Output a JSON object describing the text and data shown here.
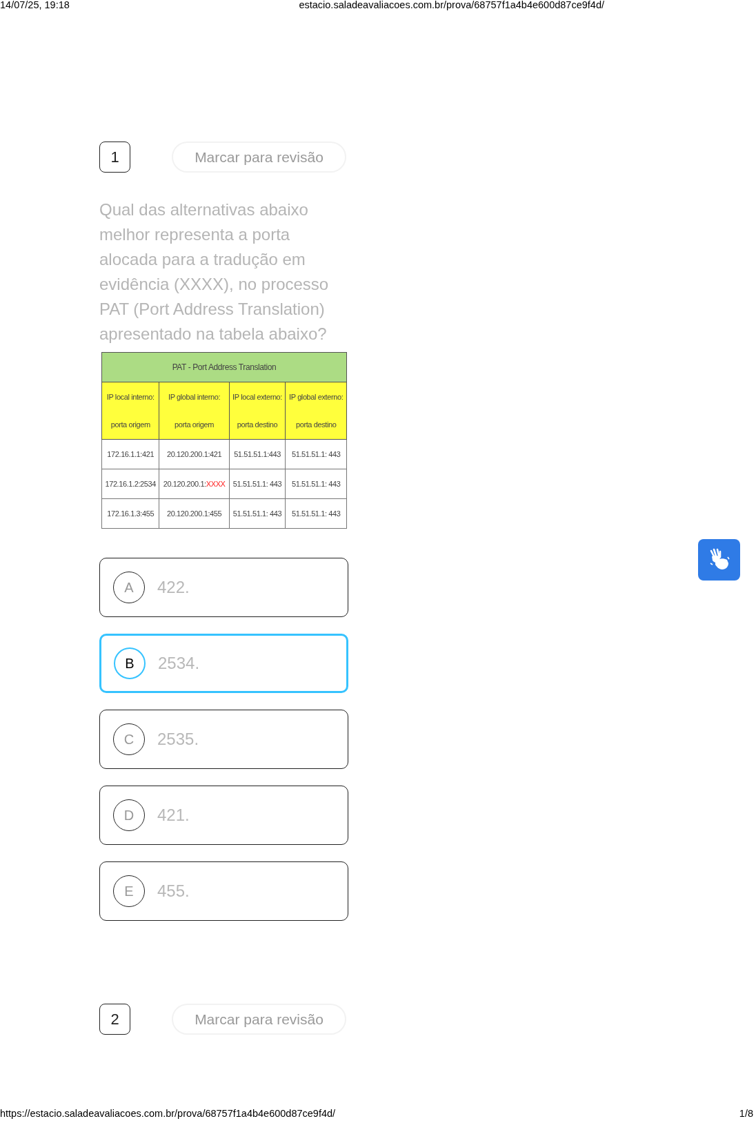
{
  "print_header": {
    "datetime": "14/07/25, 19:18",
    "url": "estacio.saladeavaliacoes.com.br/prova/68757f1a4b4e600d87ce9f4d/"
  },
  "questions": [
    {
      "number": "1",
      "review_button": "Marcar para revisão",
      "text": "Qual das alternativas abaixo melhor representa a porta alocada para a tradução em evidência (XXXX), no processo PAT (Port Address Translation) apresentado na tabela abaixo?",
      "table": {
        "title": "PAT - Port Address Translation",
        "columns": [
          "IP local interno:\nporta origem",
          "IP global interno:\nporta origem",
          "IP local externo:\nporta destino",
          "IP global externo:\nporta destino"
        ],
        "rows": [
          [
            {
              "text": "172.16.1.1:421"
            },
            {
              "text": "20.120.200.1:421"
            },
            {
              "text": "51.51.51.1:443"
            },
            {
              "text": "51.51.51.1: 443"
            }
          ],
          [
            {
              "text": "172.16.1.2:2534"
            },
            {
              "text": "20.120.200.1:",
              "highlight": "XXXX"
            },
            {
              "text": "51.51.51.1: 443"
            },
            {
              "text": "51.51.51.1: 443"
            }
          ],
          [
            {
              "text": "172.16.1.3:455"
            },
            {
              "text": "20.120.200.1:455"
            },
            {
              "text": "51.51.51.1: 443"
            },
            {
              "text": "51.51.51.1: 443"
            }
          ]
        ]
      },
      "options": [
        {
          "letter": "A",
          "text": "422.",
          "selected": false
        },
        {
          "letter": "B",
          "text": "2534.",
          "selected": true
        },
        {
          "letter": "C",
          "text": "2535.",
          "selected": false
        },
        {
          "letter": "D",
          "text": "421.",
          "selected": false
        },
        {
          "letter": "E",
          "text": "455.",
          "selected": false
        }
      ]
    },
    {
      "number": "2",
      "review_button": "Marcar para revisão"
    }
  ],
  "print_footer": {
    "url": "https://estacio.saladeavaliacoes.com.br/prova/68757f1a4b4e600d87ce9f4d/",
    "page": "1/8"
  }
}
